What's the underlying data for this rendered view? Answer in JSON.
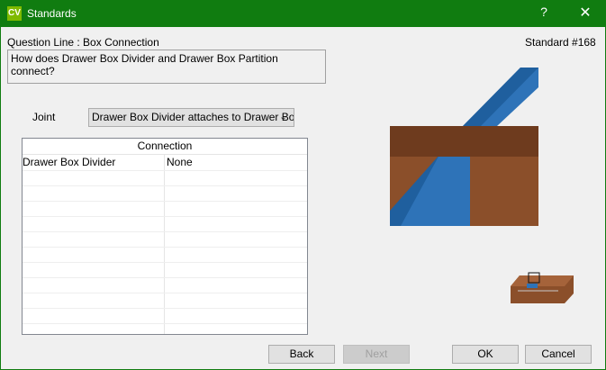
{
  "window": {
    "logo": "CV",
    "title": "Standards",
    "help": "?",
    "close": "✕"
  },
  "header": {
    "question_line": "Question Line : Box Connection",
    "standard": "Standard #168"
  },
  "question": "How does Drawer Box Divider and Drawer Box Partition connect?",
  "joint": {
    "label": "Joint",
    "selected": "Drawer Box Divider attaches to Drawer Box Partition"
  },
  "grid": {
    "header": "Connection",
    "rows": [
      {
        "part": "Drawer Box Divider",
        "connection": "None"
      }
    ]
  },
  "buttons": {
    "back": "Back",
    "next": "Next",
    "ok": "OK",
    "cancel": "Cancel"
  },
  "colors": {
    "titlebar": "#107c10",
    "wood": "#8b4f2a",
    "wood_dark": "#6e3b1e",
    "blue": "#2e73b8",
    "blue_dark": "#1f5f9e"
  }
}
